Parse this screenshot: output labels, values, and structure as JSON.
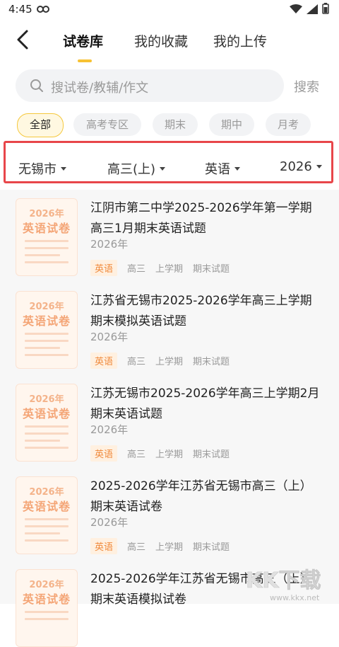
{
  "status_bar": {
    "time": "4:45"
  },
  "header": {
    "tabs": [
      {
        "label": "试卷库",
        "active": true
      },
      {
        "label": "我的收藏",
        "active": false
      },
      {
        "label": "我的上传",
        "active": false
      }
    ]
  },
  "search": {
    "placeholder": "搜试卷/教辅/作文",
    "button_label": "搜索"
  },
  "categories": [
    "全部",
    "高考专区",
    "期末",
    "期中",
    "月考"
  ],
  "filters": [
    "无锡市",
    "高三(上)",
    "英语",
    "2026"
  ],
  "colors": {
    "accent": "#f7c233",
    "highlight_border": "#e8464a",
    "tag_orange": "#f08a3c"
  },
  "papers": [
    {
      "thumb_year": "2026年",
      "thumb_title": "英语试卷",
      "title": "江阴市第二中学2025-2026学年第一学期高三1月期末英语试题",
      "year": "2026年",
      "tags": [
        "英语",
        "高三",
        "上学期",
        "期末试题"
      ]
    },
    {
      "thumb_year": "2026年",
      "thumb_title": "英语试卷",
      "title": "江苏省无锡市2025-2026学年高三上学期期末模拟英语试题",
      "year": "2026年",
      "tags": [
        "英语",
        "高三",
        "上学期",
        "期末试题"
      ]
    },
    {
      "thumb_year": "2026年",
      "thumb_title": "英语试卷",
      "title": "江苏无锡市2025-2026学年高三上学期2月期末英语试题",
      "year": "2026年",
      "tags": [
        "英语",
        "高三",
        "上学期",
        "期末试题"
      ]
    },
    {
      "thumb_year": "2026年",
      "thumb_title": "英语试卷",
      "title": "2025-2026学年江苏省无锡市高三（上）期末英语试卷",
      "year": "2026年",
      "tags": [
        "英语",
        "高三",
        "上学期",
        "期末试题"
      ]
    },
    {
      "thumb_year": "2026年",
      "thumb_title": "英语试卷",
      "title": "2025-2026学年江苏省无锡市高三（上）期末英语模拟试卷",
      "year": "",
      "tags": []
    }
  ],
  "watermark": {
    "text": "KK下载",
    "url": "www.kkx.net"
  }
}
